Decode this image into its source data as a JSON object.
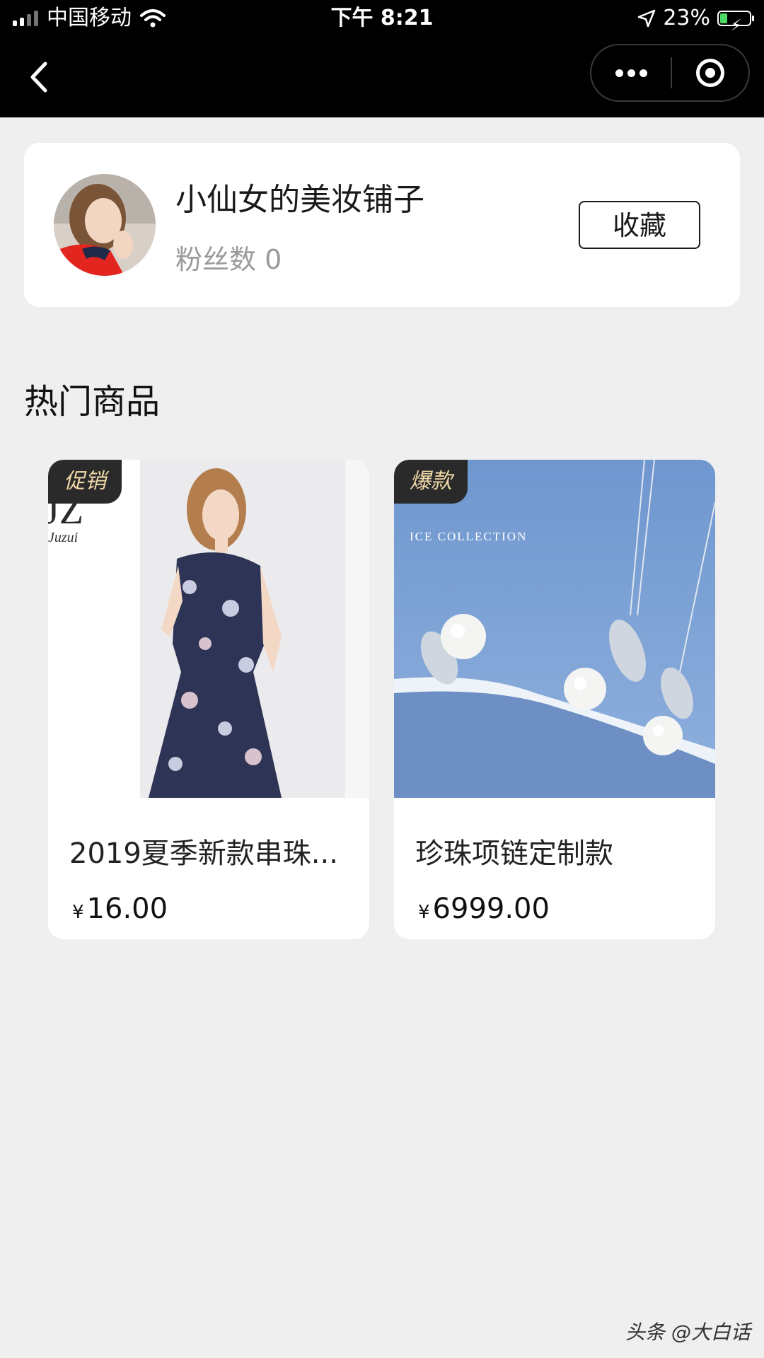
{
  "status_bar": {
    "carrier": "中国移动",
    "time": "下午 8:21",
    "battery": "23%"
  },
  "shop": {
    "name": "小仙女的美妆铺子",
    "fans_label": "粉丝数 0",
    "favorite_label": "收藏"
  },
  "section": {
    "title": "热门商品"
  },
  "products": [
    {
      "tag": "促销",
      "title": "2019夏季新款串珠...",
      "currency": "¥",
      "price": "16.00"
    },
    {
      "tag": "爆款",
      "title": "珍珠项链定制款",
      "currency": "¥",
      "price": "6999.00",
      "image_caption": "ICE COLLECTION"
    }
  ],
  "watermark": "头条 @大白话",
  "colors": {
    "nav_bg": "#000000",
    "page_bg": "#efefef",
    "tag_bg": "#2a2a2a",
    "tag_text": "#f0d9a8",
    "battery_fill": "#4cd964"
  }
}
